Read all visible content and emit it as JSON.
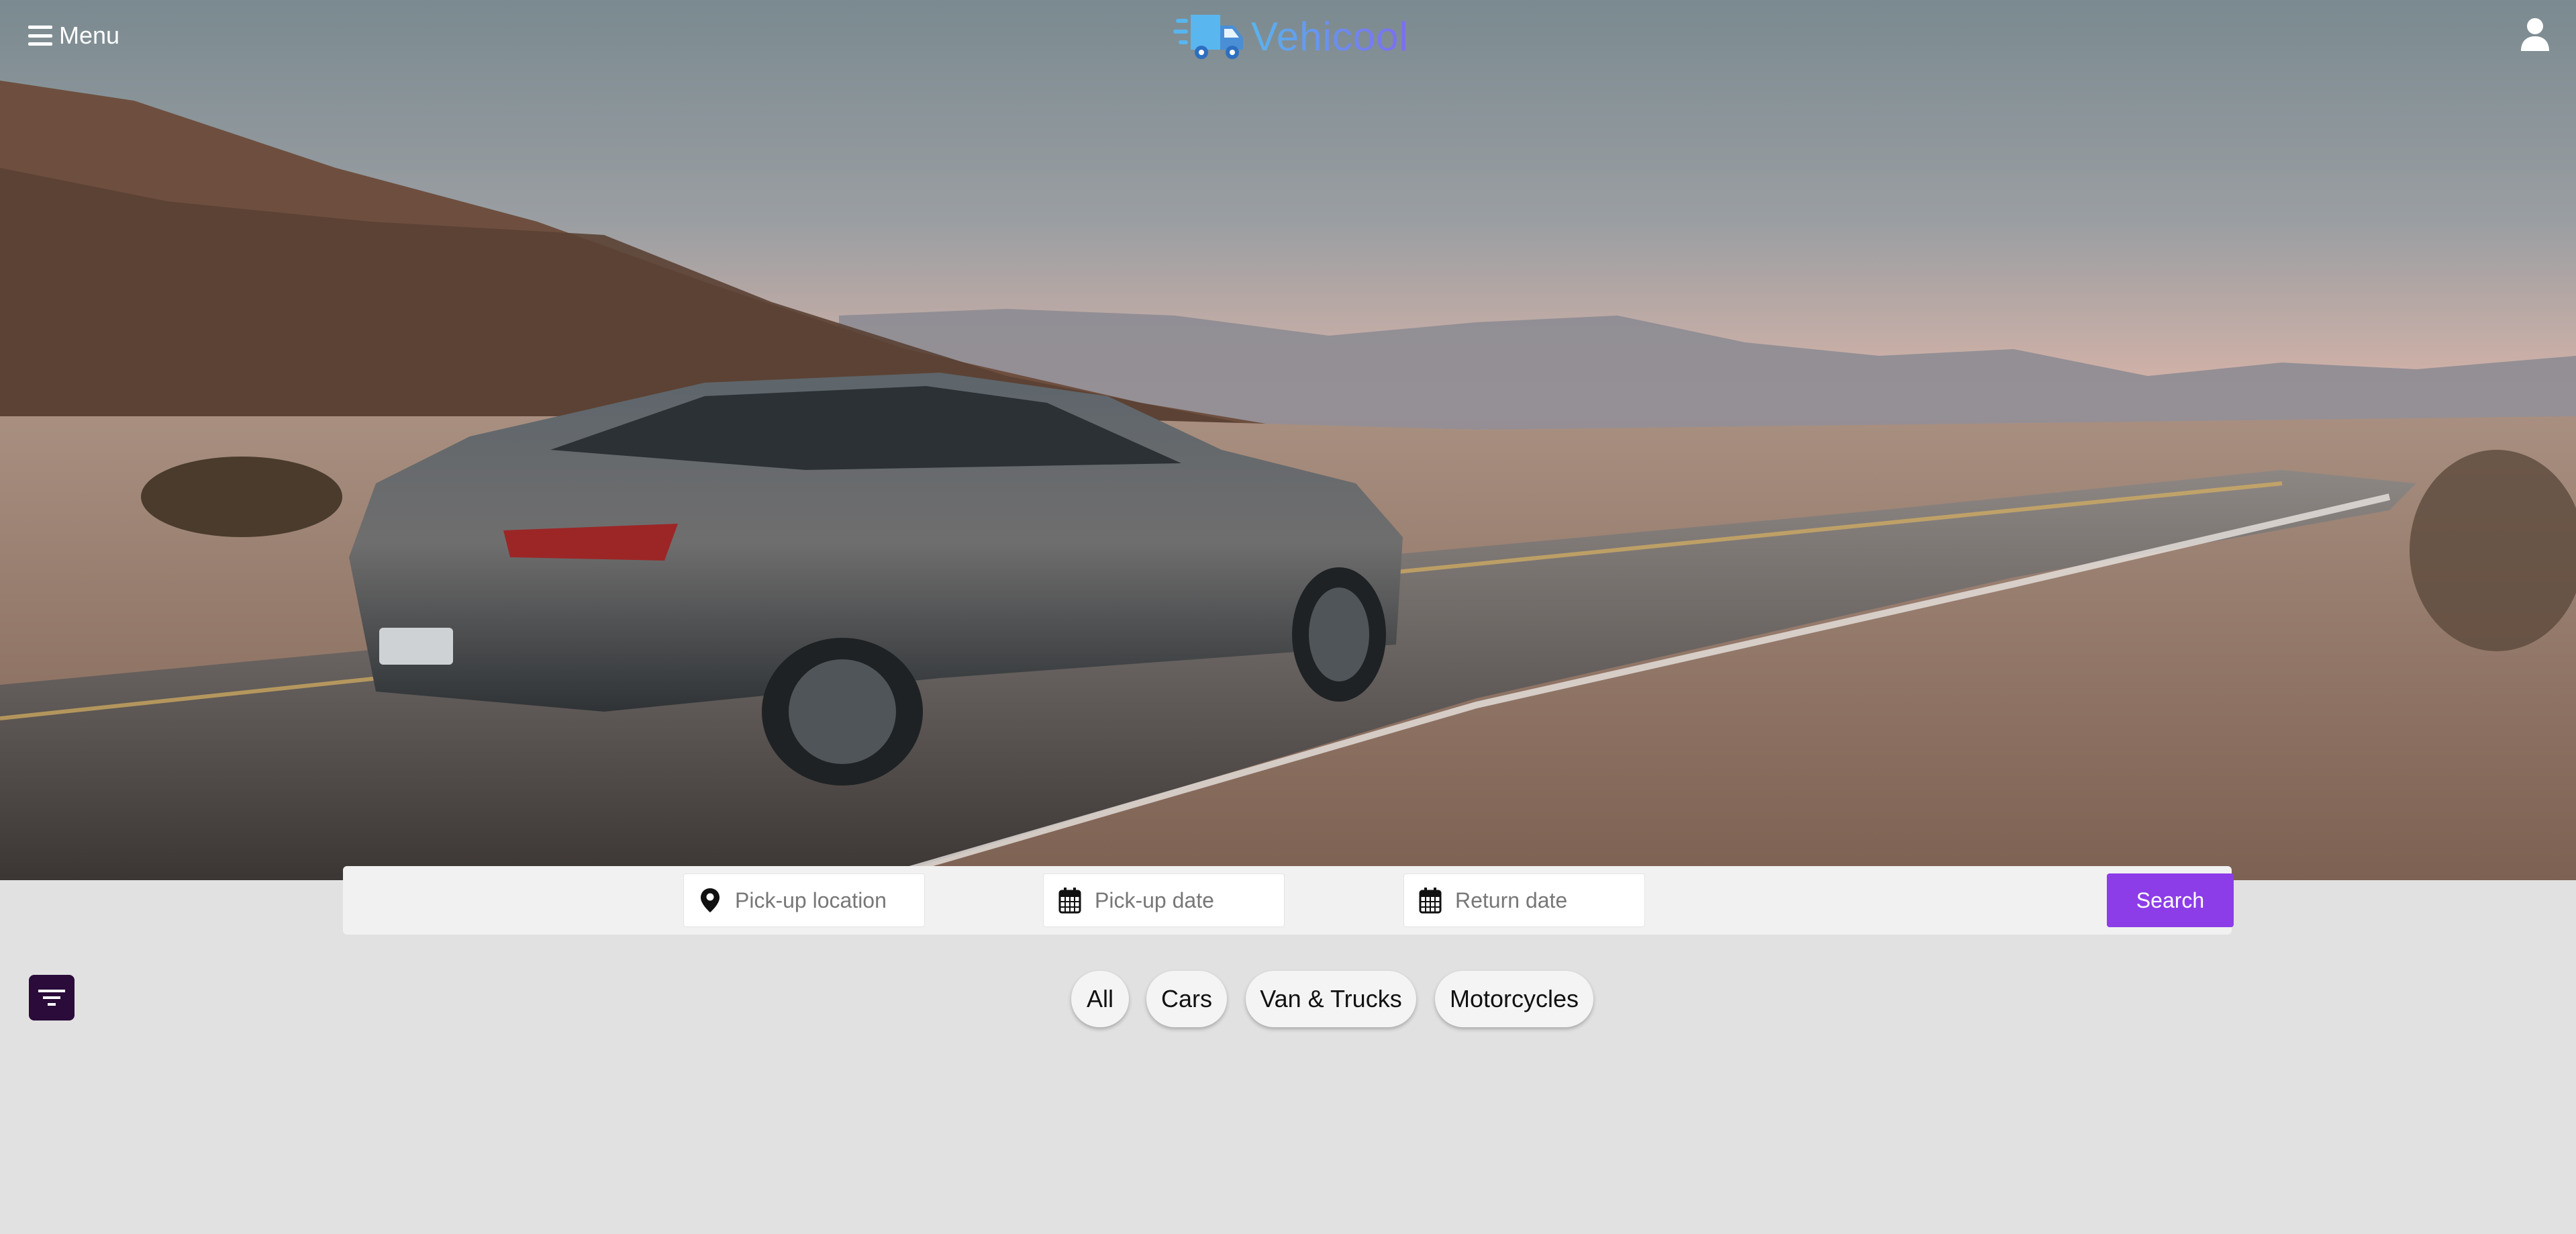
{
  "header": {
    "menu_label": "Menu",
    "logo_text": "Vehicool",
    "brand_color": "#6a8fe8"
  },
  "search": {
    "pickup_location_placeholder": "Pick-up location",
    "pickup_date_placeholder": "Pick-up date",
    "return_date_placeholder": "Return date",
    "search_label": "Search",
    "accent_color": "#8c3de8"
  },
  "categories": {
    "all": "All",
    "cars": "Cars",
    "vans_trucks": "Van & Trucks",
    "motorcycles": "Motorcycles"
  },
  "hero": {
    "image_subject": "grey sedan driving on a desert mountain road at sunset"
  }
}
